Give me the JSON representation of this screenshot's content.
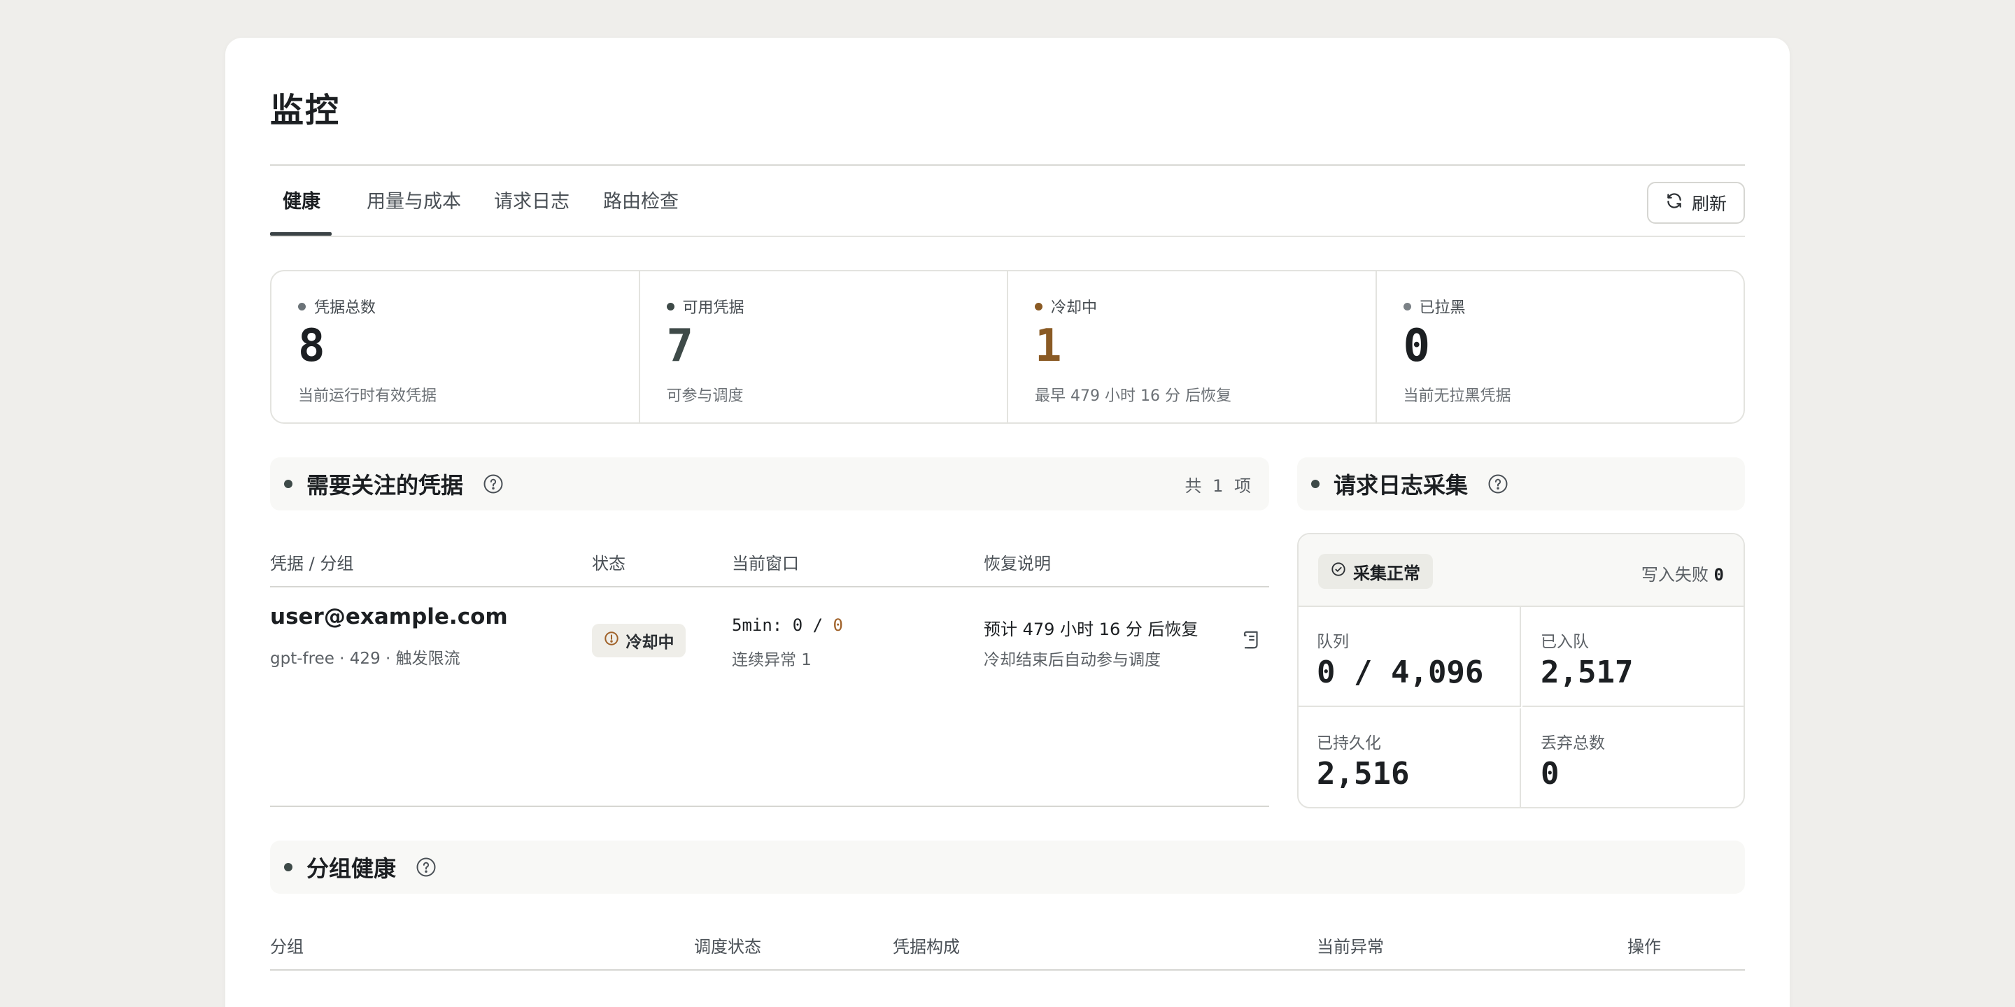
{
  "page": {
    "title": "监控"
  },
  "tabs": [
    {
      "label": "健康",
      "active": true
    },
    {
      "label": "用量与成本",
      "active": false
    },
    {
      "label": "请求日志",
      "active": false
    },
    {
      "label": "路由检查",
      "active": false
    }
  ],
  "toolbar": {
    "refresh_label": "刷新",
    "refresh_icon": "refresh-icon"
  },
  "stats": [
    {
      "label": "凭据总数",
      "value": "8",
      "sub": "当前运行时有效凭据",
      "dot_color": "#6b7378",
      "value_color": "#1c1f22"
    },
    {
      "label": "可用凭据",
      "value": "7",
      "sub": "可参与调度",
      "dot_color": "#3e4a48",
      "value_color": "#3e4a48"
    },
    {
      "label": "冷却中",
      "value": "1",
      "sub": "最早 479 小时 16 分 后恢复",
      "dot_color": "#8a5a24",
      "value_color": "#8a5a24"
    },
    {
      "label": "已拉黑",
      "value": "0",
      "sub": "当前无拉黑凭据",
      "dot_color": "#7b8186",
      "value_color": "#1c1f22"
    }
  ],
  "attention": {
    "title": "需要关注的凭据",
    "count": "共 1 项",
    "columns": [
      "凭据 / 分组",
      "状态",
      "当前窗口",
      "恢复说明"
    ],
    "rows": [
      {
        "email": "user@example.com",
        "meta": "gpt-free · 429 · 触发限流",
        "status": "冷却中",
        "window_prefix": "5min: 0 / ",
        "window_warn": "0",
        "window_sub": "连续异常 1",
        "recovery": "预计 479 小时 16 分 后恢复",
        "recovery_sub": "冷却结束后自动参与调度"
      }
    ]
  },
  "collect": {
    "title": "请求日志采集",
    "status": "采集正常",
    "fail_label": "写入失败",
    "fail_value": "0",
    "cells": [
      {
        "label": "队列",
        "value": "0 / 4,096"
      },
      {
        "label": "已入队",
        "value": "2,517"
      },
      {
        "label": "已持久化",
        "value": "2,516"
      },
      {
        "label": "丢弃总数",
        "value": "0"
      }
    ]
  },
  "groups": {
    "title": "分组健康",
    "columns": [
      "分组",
      "调度状态",
      "凭据构成",
      "当前异常",
      "操作"
    ]
  },
  "colors": {
    "accent": "#3b4346",
    "warning": "#a0622a",
    "background": "#efeeeb"
  }
}
